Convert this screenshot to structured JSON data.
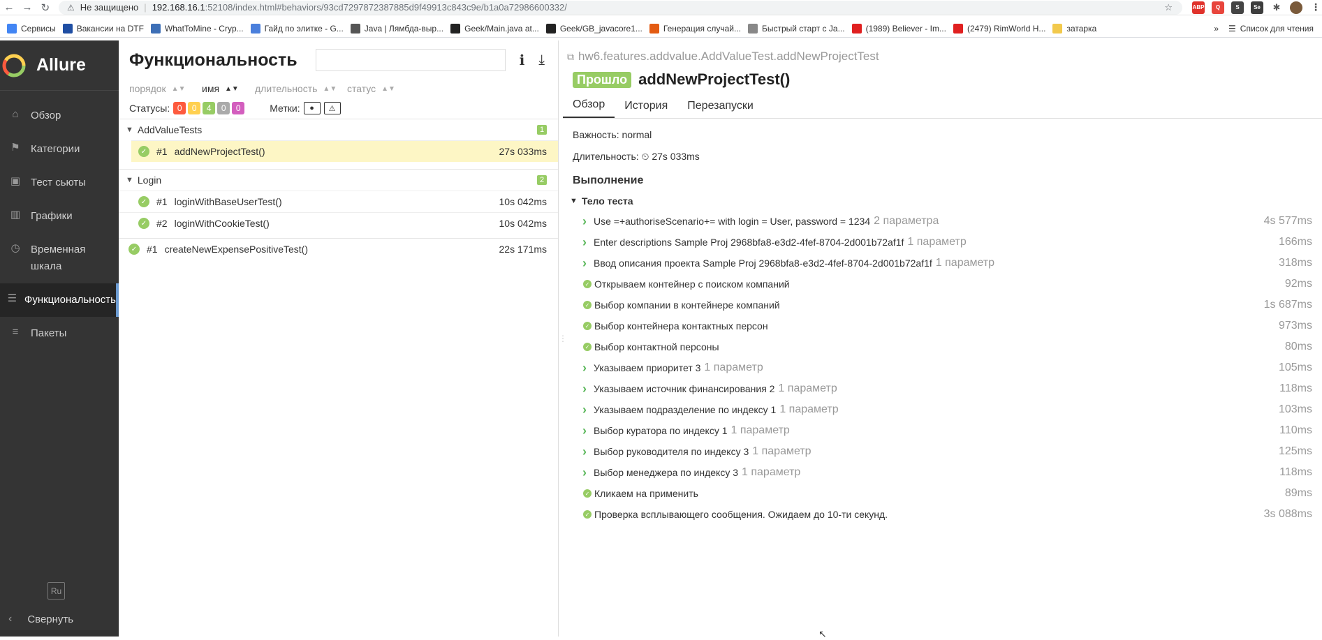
{
  "browser": {
    "security": "Не защищено",
    "url_host": "192.168.16.1",
    "url_path": ":52108/index.html#behaviors/93cd7297872387885d9f49913c843c9e/b1a0a72986600332/",
    "bookmarks": [
      {
        "label": "Сервисы",
        "color": "#4285f4"
      },
      {
        "label": "Вакансии на DTF",
        "color": "#1f4ea3"
      },
      {
        "label": "WhatToMine - Cryp...",
        "color": "#3d6fb6"
      },
      {
        "label": "Гайд по элитке - G...",
        "color": "#4a7fdc"
      },
      {
        "label": "Java | Лямбда-выр...",
        "color": "#555555"
      },
      {
        "label": "Geek/Main.java at...",
        "color": "#222222"
      },
      {
        "label": "Geek/GB_javacore1...",
        "color": "#222222"
      },
      {
        "label": "Генерация случай...",
        "color": "#e35b12"
      },
      {
        "label": "Быстрый старт с Ja...",
        "color": "#888888"
      },
      {
        "label": "(1989) Believer - Im...",
        "color": "#e02020"
      },
      {
        "label": "(2479) RimWorld H...",
        "color": "#e02020"
      },
      {
        "label": "затарка",
        "color": "#f2c94c"
      }
    ],
    "reading_list": "Список для чтения",
    "more": "»"
  },
  "sidebar": {
    "brand": "Allure",
    "items": [
      {
        "label": "Обзор",
        "icon": "home-icon"
      },
      {
        "label": "Категории",
        "icon": "flag-icon"
      },
      {
        "label": "Тест сьюты",
        "icon": "briefcase-icon"
      },
      {
        "label": "Графики",
        "icon": "bar-chart-icon"
      },
      {
        "label": "Временная шкала",
        "icon": "clock-icon"
      },
      {
        "label": "Функциональность",
        "icon": "list-icon"
      },
      {
        "label": "Пакеты",
        "icon": "align-left-icon"
      }
    ],
    "lang": "Ru",
    "collapse": "Свернуть"
  },
  "tree": {
    "title": "Функциональность",
    "sort": {
      "order": "порядок",
      "name": "имя",
      "duration": "длительность",
      "status": "статус"
    },
    "statuses_label": "Статусы:",
    "statuses": [
      {
        "value": "0",
        "color": "#fd5a3e"
      },
      {
        "value": "0",
        "color": "#ffd050"
      },
      {
        "value": "4",
        "color": "#97cc64"
      },
      {
        "value": "0",
        "color": "#aaaaaa"
      },
      {
        "value": "0",
        "color": "#d35ebe"
      }
    ],
    "marks_label": "Метки:",
    "groups": [
      {
        "name": "AddValueTests",
        "count": "1",
        "tests": [
          {
            "num": "#1",
            "name": "addNewProjectTest()",
            "duration": "27s 033ms",
            "selected": true
          }
        ]
      },
      {
        "name": "Login",
        "count": "2",
        "tests": [
          {
            "num": "#1",
            "name": "loginWithBaseUserTest()",
            "duration": "10s 042ms"
          },
          {
            "num": "#2",
            "name": "loginWithCookieTest()",
            "duration": "10s 042ms"
          }
        ]
      }
    ],
    "standalone": {
      "num": "#1",
      "name": "createNewExpensePositiveTest()",
      "duration": "22s 171ms"
    }
  },
  "details": {
    "path": "hw6.features.addvalue.AddValueTest.addNewProjectTest",
    "status": "Прошло",
    "name": "addNewProjectTest()",
    "tabs": [
      "Обзор",
      "История",
      "Перезапуски"
    ],
    "severity": "Важность: normal",
    "duration_label": "Длительность:",
    "duration": "27s 033ms",
    "execution": "Выполнение",
    "body": "Тело теста",
    "steps": [
      {
        "text": "Use =+authoriseScenario+= with login = User, password = 1234",
        "param": "2 параметра",
        "dur": "4s 577ms",
        "expand": true
      },
      {
        "text": "Enter descriptions Sample Proj 2968bfa8-e3d2-4fef-8704-2d001b72af1f",
        "param": "1 параметр",
        "dur": "166ms",
        "expand": true
      },
      {
        "text": "Ввод описания проекта Sample Proj 2968bfa8-e3d2-4fef-8704-2d001b72af1f",
        "param": "1 параметр",
        "dur": "318ms",
        "expand": true
      },
      {
        "text": "Открываем контейнер с поиском компаний",
        "param": "",
        "dur": "92ms",
        "expand": false
      },
      {
        "text": "Выбор компании в контейнере компаний",
        "param": "",
        "dur": "1s 687ms",
        "expand": false
      },
      {
        "text": "Выбор контейнера контактных персон",
        "param": "",
        "dur": "973ms",
        "expand": false
      },
      {
        "text": "Выбор контактной персоны",
        "param": "",
        "dur": "80ms",
        "expand": false
      },
      {
        "text": "Указываем приоритет 3",
        "param": "1 параметр",
        "dur": "105ms",
        "expand": true
      },
      {
        "text": "Указываем источник финансирования 2",
        "param": "1 параметр",
        "dur": "118ms",
        "expand": true
      },
      {
        "text": "Указываем подразделение по индексу 1",
        "param": "1 параметр",
        "dur": "103ms",
        "expand": true
      },
      {
        "text": "Выбор куратора по индексу 1",
        "param": "1 параметр",
        "dur": "110ms",
        "expand": true
      },
      {
        "text": "Выбор руководителя по индексу 3",
        "param": "1 параметр",
        "dur": "125ms",
        "expand": true
      },
      {
        "text": "Выбор менеджера по индексу 3",
        "param": "1 параметр",
        "dur": "118ms",
        "expand": true
      },
      {
        "text": "Кликаем на применить",
        "param": "",
        "dur": "89ms",
        "expand": false
      },
      {
        "text": "Проверка всплывающего сообщения. Ожидаем до 10-ти секунд.",
        "param": "",
        "dur": "3s 088ms",
        "expand": false
      }
    ]
  }
}
